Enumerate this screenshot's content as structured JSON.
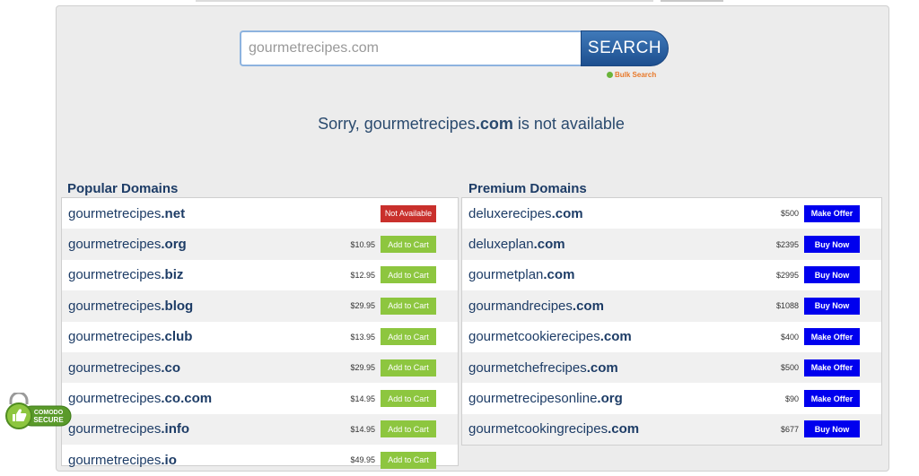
{
  "search": {
    "value": "gourmetrecipes.com",
    "button_label": "SEARCH",
    "bulk_label": "Bulk Search"
  },
  "message": {
    "prefix": "Sorry, gourmetrecipes",
    "tld": ".com",
    "suffix": " is not available"
  },
  "popular": {
    "title": "Popular Domains",
    "rows": [
      {
        "name": "gourmetrecipes",
        "tld": ".net",
        "price": "",
        "action": "Not Available"
      },
      {
        "name": "gourmetrecipes",
        "tld": ".org",
        "price": "$10.95",
        "action": "Add to Cart"
      },
      {
        "name": "gourmetrecipes",
        "tld": ".biz",
        "price": "$12.95",
        "action": "Add to Cart"
      },
      {
        "name": "gourmetrecipes",
        "tld": ".blog",
        "price": "$29.95",
        "action": "Add to Cart"
      },
      {
        "name": "gourmetrecipes",
        "tld": ".club",
        "price": "$13.95",
        "action": "Add to Cart"
      },
      {
        "name": "gourmetrecipes",
        "tld": ".co",
        "price": "$29.95",
        "action": "Add to Cart"
      },
      {
        "name": "gourmetrecipes",
        "tld": ".co.com",
        "price": "$14.95",
        "action": "Add to Cart"
      },
      {
        "name": "gourmetrecipes",
        "tld": ".info",
        "price": "$14.95",
        "action": "Add to Cart"
      },
      {
        "name": "gourmetrecipes",
        "tld": ".io",
        "price": "$49.95",
        "action": "Add to Cart"
      }
    ]
  },
  "premium": {
    "title": "Premium Domains",
    "rows": [
      {
        "name": "deluxerecipes",
        "tld": ".com",
        "price": "$500",
        "action": "Make Offer"
      },
      {
        "name": "deluxeplan",
        "tld": ".com",
        "price": "$2395",
        "action": "Buy Now"
      },
      {
        "name": "gourmetplan",
        "tld": ".com",
        "price": "$2995",
        "action": "Buy Now"
      },
      {
        "name": "gourmandrecipes",
        "tld": ".com",
        "price": "$1088",
        "action": "Buy Now"
      },
      {
        "name": "gourmetcookierecipes",
        "tld": ".com",
        "price": "$400",
        "action": "Make Offer"
      },
      {
        "name": "gourmetchefrecipes",
        "tld": ".com",
        "price": "$500",
        "action": "Make Offer"
      },
      {
        "name": "gourmetrecipesonline",
        "tld": ".org",
        "price": "$90",
        "action": "Make Offer"
      },
      {
        "name": "gourmetcookingrecipes",
        "tld": ".com",
        "price": "$677",
        "action": "Buy Now"
      }
    ]
  },
  "badge": {
    "line1": "COMODO",
    "line2": "SECURE"
  },
  "colors": {
    "add_to_cart": "#8dc63f",
    "not_available": "#c9302c",
    "offer": "#0000ee",
    "heading": "#1d3c66"
  }
}
